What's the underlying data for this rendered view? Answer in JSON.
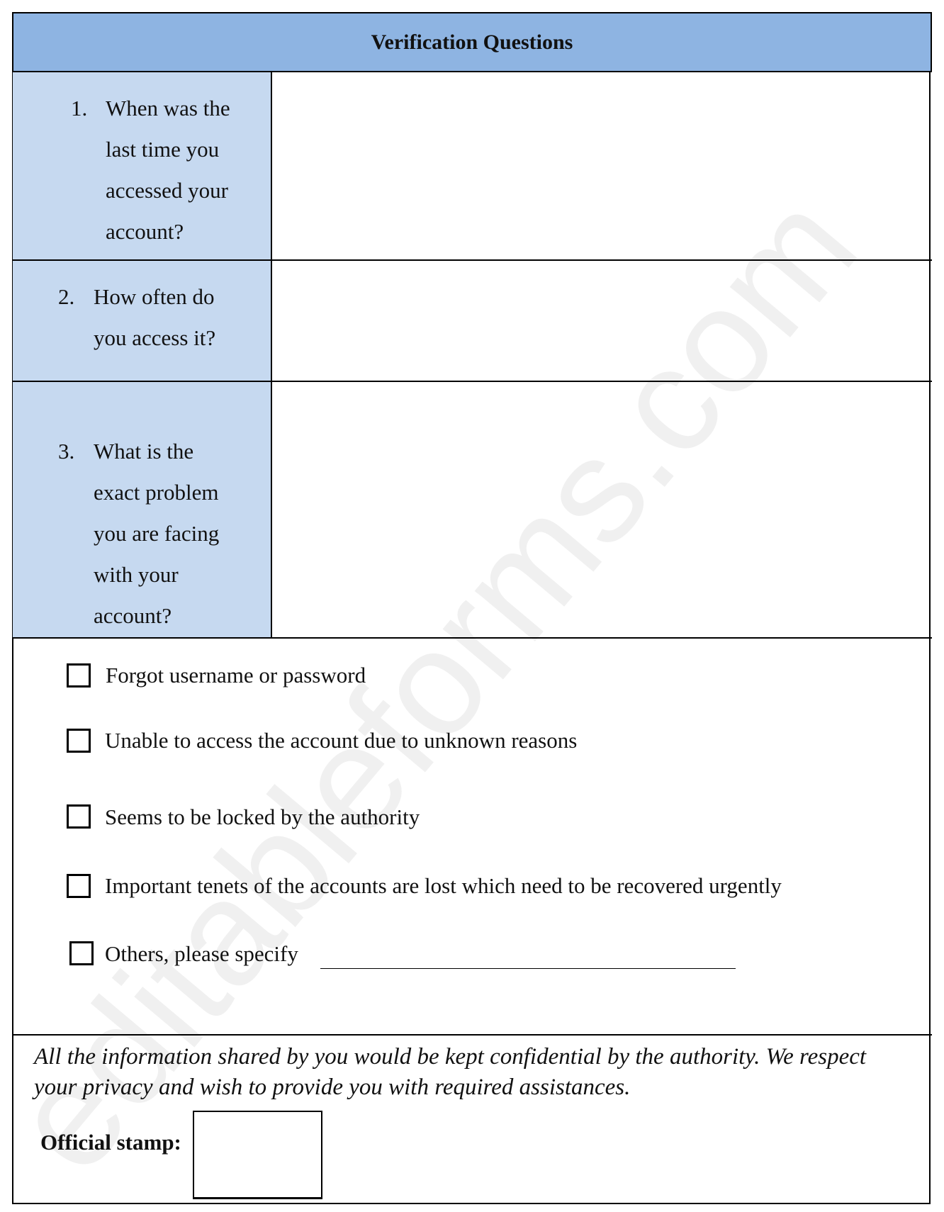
{
  "title": "Verification Questions",
  "watermark": "editableforms.com",
  "questions": [
    {
      "number": "1.",
      "lines": [
        "When was the",
        "last time you",
        "accessed your",
        "account?"
      ]
    },
    {
      "number": "2.",
      "lines": [
        "How often do",
        "you access it?"
      ]
    },
    {
      "number": "3.",
      "lines": [
        "What is the",
        "exact problem",
        "you are facing",
        "with your",
        "account?"
      ]
    }
  ],
  "options": [
    {
      "label": "Forgot username or password",
      "checked": false
    },
    {
      "label": "Unable to access the account due to unknown reasons",
      "checked": false
    },
    {
      "label": "Seems to be locked by the authority",
      "checked": false
    },
    {
      "label": "Important tenets of the accounts are lost which need to be recovered urgently",
      "checked": false
    },
    {
      "label": "Others, please specify",
      "checked": false
    }
  ],
  "note": "All the information shared by you would be kept confidential by the authority. We respect your privacy and wish to provide you with required assistances.",
  "stamp_label": "Official stamp:"
}
